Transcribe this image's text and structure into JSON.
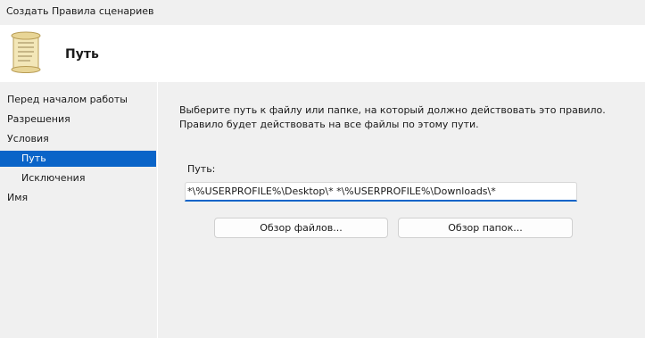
{
  "window": {
    "title": "Создать Правила сценариев"
  },
  "header": {
    "heading": "Путь",
    "icon": "scroll-icon"
  },
  "sidebar": {
    "items": [
      {
        "label": "Перед началом работы",
        "selected": false
      },
      {
        "label": "Разрешения",
        "selected": false
      },
      {
        "label": "Условия",
        "selected": false
      },
      {
        "label": "Путь",
        "selected": true
      },
      {
        "label": "Исключения",
        "selected": false
      },
      {
        "label": "Имя",
        "selected": false
      }
    ]
  },
  "main": {
    "description_line1": "Выберите путь к файлу или папке, на который должно действовать это правило.",
    "description_line2": "Правило будет действовать на все файлы по этому пути.",
    "path_label": "Путь:",
    "path_value": "*\\%USERPROFILE%\\Desktop\\* *\\%USERPROFILE%\\Downloads\\*",
    "browse_files_label": "Обзор файлов...",
    "browse_folders_label": "Обзор папок..."
  },
  "colors": {
    "selection": "#0a64c8",
    "header_bg": "#ffffff",
    "window_bg": "#f0f0f0"
  }
}
